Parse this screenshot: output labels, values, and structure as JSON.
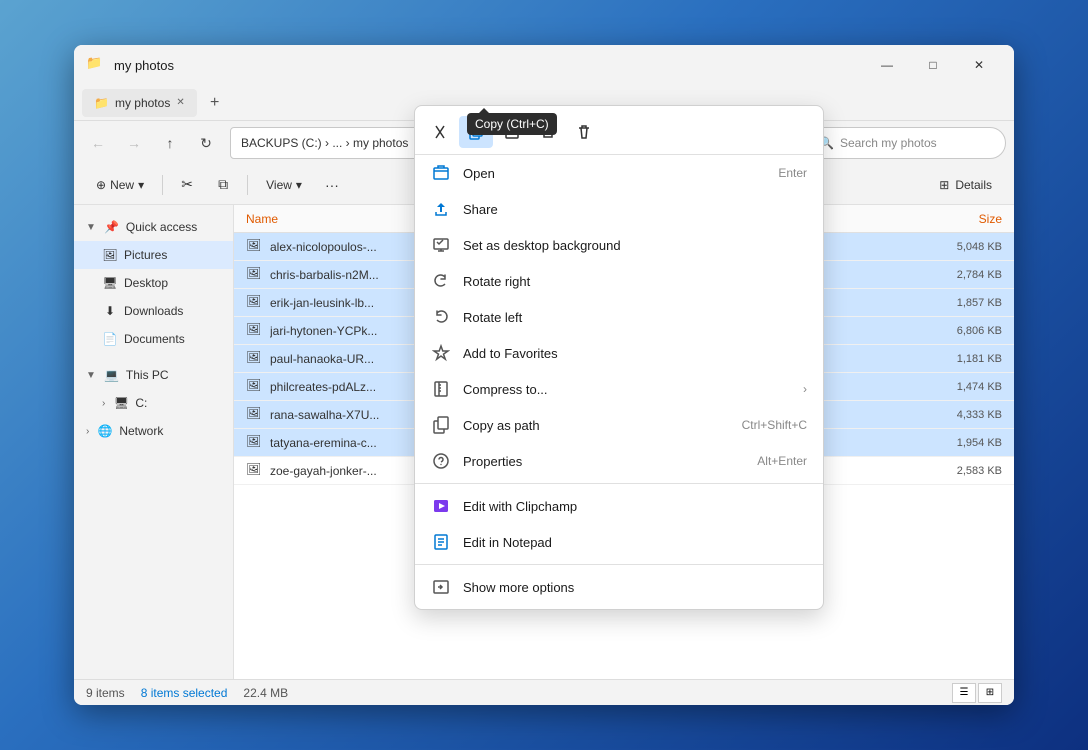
{
  "window": {
    "title": "my photos",
    "folder_icon": "📁"
  },
  "title_controls": {
    "minimize": "—",
    "maximize": "□",
    "close": "✕"
  },
  "tab": {
    "label": "my photos",
    "close": "✕",
    "new": "+"
  },
  "nav": {
    "back": "←",
    "forward": "→",
    "up": "↑",
    "refresh": "↻",
    "address": "BACKUPS (C:) › ... › my photos",
    "search_placeholder": "Search my photos"
  },
  "toolbar": {
    "new_label": "New",
    "new_dropdown": "▾",
    "cut_icon": "✂",
    "copy_icon": "⧉",
    "view_label": "View",
    "view_dropdown": "▾",
    "more_icon": "···",
    "details_label": "Details"
  },
  "file_list": {
    "columns": {
      "name": "Name",
      "size": "Size"
    },
    "files": [
      {
        "name": "alex-nicolopoulos-...",
        "size": "5,048 KB",
        "selected": true
      },
      {
        "name": "chris-barbalis-n2M...",
        "size": "2,784 KB",
        "selected": true
      },
      {
        "name": "erik-jan-leusink-lb...",
        "size": "1,857 KB",
        "selected": true
      },
      {
        "name": "jari-hytonen-YCPk...",
        "size": "6,806 KB",
        "selected": true
      },
      {
        "name": "paul-hanaoka-UR...",
        "size": "1,181 KB",
        "selected": true
      },
      {
        "name": "philcreates-pdALz...",
        "size": "1,474 KB",
        "selected": true
      },
      {
        "name": "rana-sawalha-X7U...",
        "size": "4,333 KB",
        "selected": true
      },
      {
        "name": "tatyana-eremina-c...",
        "size": "1,954 KB",
        "selected": true
      },
      {
        "name": "zoe-gayah-jonker-...",
        "size": "2,583 KB",
        "selected": false
      }
    ]
  },
  "status_bar": {
    "total": "9 items",
    "selected": "8 items selected",
    "size": "22.4 MB"
  },
  "sidebar": {
    "items": [
      {
        "label": "Quick access",
        "icon": "📌",
        "expand": true
      },
      {
        "label": "Pictures",
        "icon": "🖼",
        "active": true
      },
      {
        "label": "Desktop",
        "icon": "🖥"
      },
      {
        "label": "Downloads",
        "icon": "⬇"
      },
      {
        "label": "Documents",
        "icon": "📄"
      },
      {
        "label": "This PC",
        "icon": "💻",
        "expand": true,
        "expanded": true
      },
      {
        "label": "Network",
        "icon": "🌐",
        "expand": true
      }
    ]
  },
  "context_menu": {
    "tooltip": "Copy (Ctrl+C)",
    "mini_toolbar": [
      {
        "icon": "✂",
        "label": "cut"
      },
      {
        "icon": "⧉",
        "label": "copy",
        "active": true
      },
      {
        "icon": "A",
        "label": "rename"
      },
      {
        "icon": "↗",
        "label": "share"
      },
      {
        "icon": "🗑",
        "label": "delete"
      }
    ],
    "items": [
      {
        "label": "Open",
        "shortcut": "Enter",
        "icon": "📂"
      },
      {
        "label": "Share",
        "shortcut": "",
        "icon": "↗"
      },
      {
        "label": "Set as desktop background",
        "shortcut": "",
        "icon": "🖼"
      },
      {
        "label": "Rotate right",
        "shortcut": "",
        "icon": "↻"
      },
      {
        "label": "Rotate left",
        "shortcut": "",
        "icon": "↺"
      },
      {
        "label": "Add to Favorites",
        "shortcut": "",
        "icon": "☆"
      },
      {
        "label": "Compress to...",
        "shortcut": "",
        "icon": "📦",
        "arrow": true
      },
      {
        "label": "Copy as path",
        "shortcut": "Ctrl+Shift+C",
        "icon": "📋"
      },
      {
        "label": "Properties",
        "shortcut": "Alt+Enter",
        "icon": "🔧"
      },
      {
        "separator": true
      },
      {
        "label": "Edit with Clipchamp",
        "shortcut": "",
        "icon": "🎬"
      },
      {
        "label": "Edit in Notepad",
        "shortcut": "",
        "icon": "📝"
      },
      {
        "separator": true
      },
      {
        "label": "Show more options",
        "shortcut": "",
        "icon": "↗"
      }
    ]
  }
}
